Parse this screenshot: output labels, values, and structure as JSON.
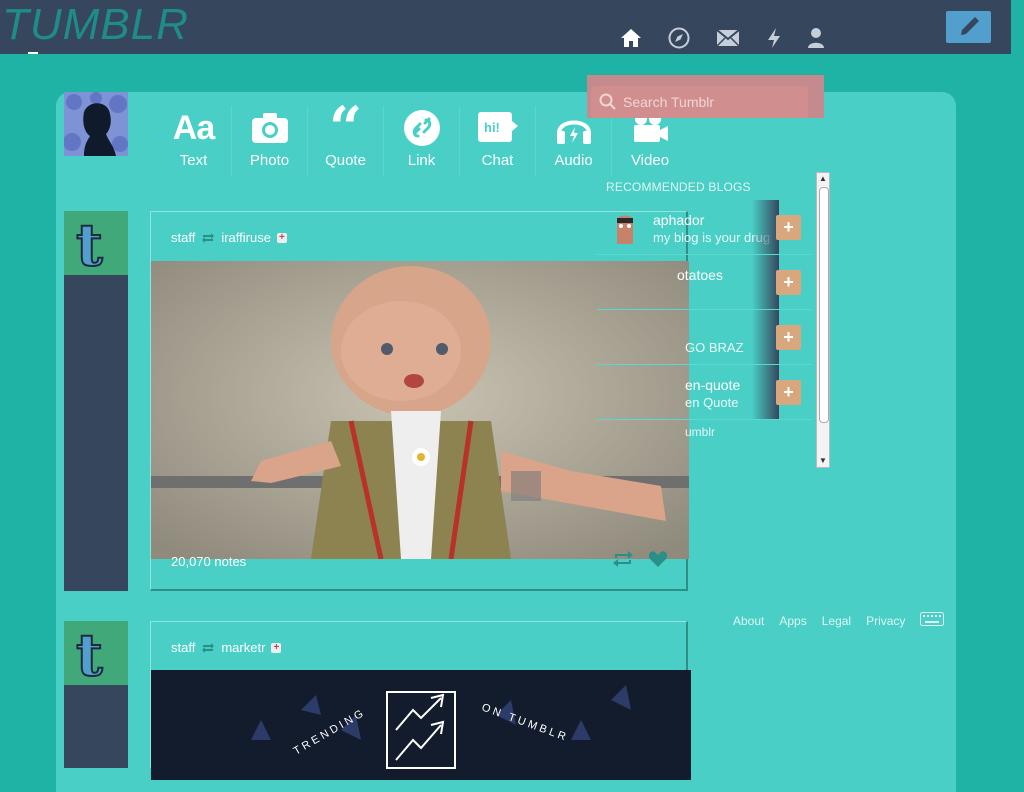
{
  "app": {
    "logo": "TUMBLR"
  },
  "nav": {
    "icons": [
      "home-icon",
      "explore-icon",
      "inbox-icon",
      "activity-icon",
      "account-icon"
    ],
    "compose_icon": "pencil-icon"
  },
  "post_types": [
    {
      "label": "Text",
      "icon": "text-icon"
    },
    {
      "label": "Photo",
      "icon": "camera-icon"
    },
    {
      "label": "Quote",
      "icon": "quote-icon"
    },
    {
      "label": "Link",
      "icon": "link-icon"
    },
    {
      "label": "Chat",
      "icon": "chat-icon",
      "glyph": "hi!"
    },
    {
      "label": "Audio",
      "icon": "headphones-icon"
    },
    {
      "label": "Video",
      "icon": "video-camera-icon"
    }
  ],
  "search": {
    "placeholder": "Search Tumblr"
  },
  "recommended": {
    "title": "RECOMMENDED BLOGS",
    "items": [
      {
        "name": "aphador",
        "sub": "my blog is your drug"
      },
      {
        "name": "otatoes",
        "sub": ""
      },
      {
        "name": "",
        "sub": "GO BRAZ"
      },
      {
        "name": "en-quote",
        "sub": "en Quote"
      }
    ],
    "footer": "umblr"
  },
  "posts": [
    {
      "author": "staff",
      "reblogged_from": "iraffiruse",
      "notes": "20,070 notes"
    },
    {
      "author": "staff",
      "reblogged_from": "marketr",
      "image_text_left": "TRENDING",
      "image_text_right": "ON TUMBLR"
    }
  ],
  "footer": {
    "links": [
      "About",
      "Apps",
      "Legal",
      "Privacy"
    ]
  },
  "colors": {
    "background": "#1fb3a6",
    "header": "#36465d",
    "dashboard": "#49cfc6",
    "compose": "#529ecc",
    "search": "#c58a8d"
  }
}
